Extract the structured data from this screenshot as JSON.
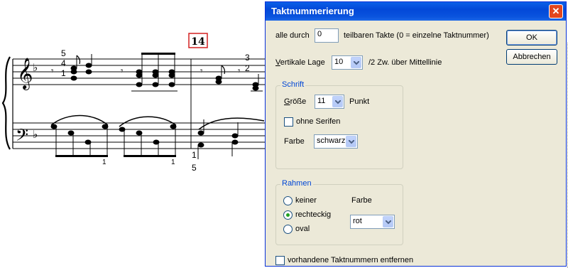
{
  "score": {
    "measure_number": "14",
    "finger_left": [
      "5",
      "4",
      "1"
    ],
    "finger_right": [
      "3",
      "2"
    ],
    "finger_bass_bottom": [
      "1",
      "5"
    ],
    "finger_bass_one_a": "1",
    "finger_bass_one_b": "1"
  },
  "dialog": {
    "title": "Taktnummerierung",
    "close_icon": "close-icon",
    "interval_label": "alle durch",
    "interval_value": "0",
    "interval_suffix": "teilbaren Takte (0 = einzelne Taktnummer)",
    "vertical_label_u": "V",
    "vertical_label_rest": "ertikale Lage",
    "vertical_value": "10",
    "vertical_suffix": "/2 Zw. über Mittellinie",
    "ok_label": "OK",
    "cancel_label": "Abbrechen",
    "font_group": {
      "legend": "Schrift",
      "size_label_u": "G",
      "size_label_rest": "röße",
      "size_value": "11",
      "size_unit": "Punkt",
      "sans_serif_label": "ohne Serifen",
      "color_label": "Farbe",
      "color_value": "schwarz"
    },
    "frame_group": {
      "legend": "Rahmen",
      "options": [
        "keiner",
        "rechteckig",
        "oval"
      ],
      "selected": "rechteckig",
      "color_label": "Farbe",
      "color_value": "rot"
    },
    "remove_label": "vorhandene Taktnummern entfernen"
  },
  "colors": {
    "titlebar": "#0a5fe8",
    "dialog_bg": "#ece9d8",
    "measure_box": "#d42020",
    "group_legend": "#0046d5"
  }
}
